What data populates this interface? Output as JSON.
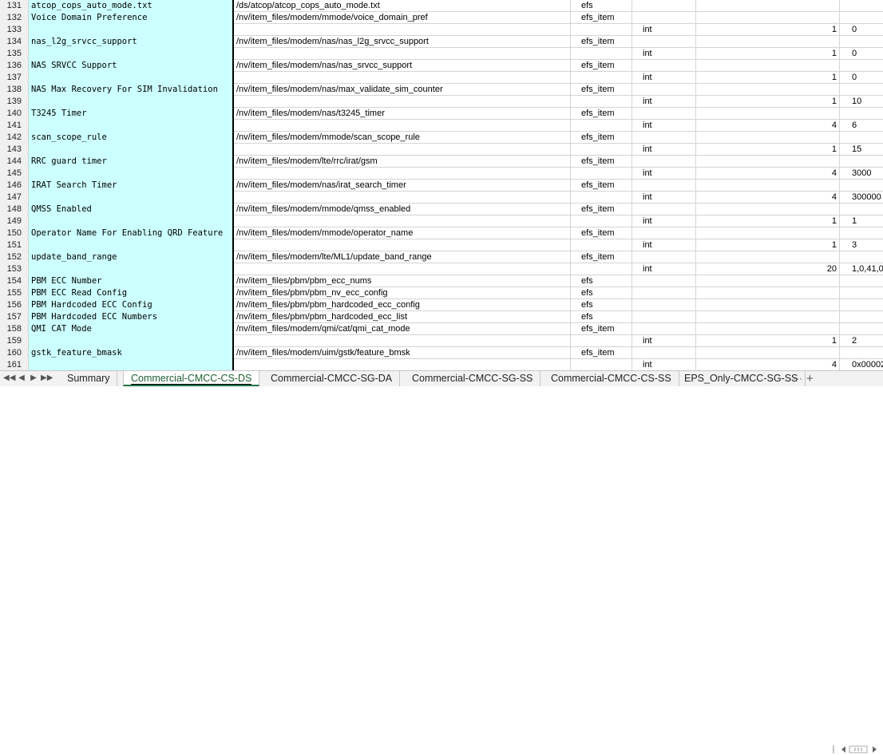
{
  "rows": [
    {
      "num": "131",
      "name": "atcop_cops_auto_mode.txt",
      "path": "/ds/atcop/atcop_cops_auto_mode.txt",
      "type": "efs",
      "c4": "",
      "size": "",
      "val": ""
    },
    {
      "num": "132",
      "name": "Voice Domain Preference",
      "path": "/nv/item_files/modem/mmode/voice_domain_pref",
      "type": "efs_item",
      "c4": "",
      "size": "",
      "val": ""
    },
    {
      "num": "133",
      "name": "",
      "path": "",
      "type": "",
      "c4": "int",
      "size": "1",
      "val": "0"
    },
    {
      "num": "134",
      "name": "nas_l2g_srvcc_support",
      "path": "/nv/item_files/modem/nas/nas_l2g_srvcc_support",
      "type": "efs_item",
      "c4": "",
      "size": "",
      "val": ""
    },
    {
      "num": "135",
      "name": "",
      "path": "",
      "type": "",
      "c4": "int",
      "size": "1",
      "val": "0"
    },
    {
      "num": "136",
      "name": "NAS SRVCC Support",
      "path": "/nv/item_files/modem/nas/nas_srvcc_support",
      "type": "efs_item",
      "c4": "",
      "size": "",
      "val": ""
    },
    {
      "num": "137",
      "name": "",
      "path": "",
      "type": "",
      "c4": "int",
      "size": "1",
      "val": "0"
    },
    {
      "num": "138",
      "name": "NAS Max Recovery For SIM Invalidation",
      "path": "/nv/item_files/modem/nas/max_validate_sim_counter",
      "type": "efs_item",
      "c4": "",
      "size": "",
      "val": ""
    },
    {
      "num": "139",
      "name": "",
      "path": "",
      "type": "",
      "c4": "int",
      "size": "1",
      "val": "10"
    },
    {
      "num": "140",
      "name": "T3245 Timer",
      "path": "/nv/item_files/modem/nas/t3245_timer",
      "type": "efs_item",
      "c4": "",
      "size": "",
      "val": ""
    },
    {
      "num": "141",
      "name": "",
      "path": "",
      "type": "",
      "c4": "int",
      "size": "4",
      "val": "6"
    },
    {
      "num": "142",
      "name": "scan_scope_rule",
      "path": "/nv/item_files/modem/mmode/scan_scope_rule",
      "type": "efs_item",
      "c4": "",
      "size": "",
      "val": ""
    },
    {
      "num": "143",
      "name": "",
      "path": "",
      "type": "",
      "c4": "int",
      "size": "1",
      "val": "15"
    },
    {
      "num": "144",
      "name": "RRC guard timer",
      "path": "/nv/item_files/modem/lte/rrc/irat/gsm",
      "type": "efs_item",
      "c4": "",
      "size": "",
      "val": ""
    },
    {
      "num": "145",
      "name": "",
      "path": "",
      "type": "",
      "c4": "int",
      "size": "4",
      "val": "3000"
    },
    {
      "num": "146",
      "name": "IRAT Search Timer",
      "path": "/nv/item_files/modem/nas/irat_search_timer",
      "type": "efs_item",
      "c4": "",
      "size": "",
      "val": ""
    },
    {
      "num": "147",
      "name": "",
      "path": "",
      "type": "",
      "c4": "int",
      "size": "4",
      "val": "300000"
    },
    {
      "num": "148",
      "name": "QMSS Enabled",
      "path": "/nv/item_files/modem/mmode/qmss_enabled",
      "type": "efs_item",
      "c4": "",
      "size": "",
      "val": ""
    },
    {
      "num": "149",
      "name": "",
      "path": "",
      "type": "",
      "c4": "int",
      "size": "1",
      "val": "1"
    },
    {
      "num": "150",
      "name": "Operator Name For Enabling QRD Feature",
      "path": "/nv/item_files/modem/mmode/operator_name",
      "type": "efs_item",
      "c4": "",
      "size": "",
      "val": ""
    },
    {
      "num": "151",
      "name": "",
      "path": "",
      "type": "",
      "c4": "int",
      "size": "1",
      "val": "3"
    },
    {
      "num": "152",
      "name": "update_band_range",
      "path": "/nv/item_files/modem/lte/ML1/update_band_range",
      "type": "efs_item",
      "c4": "",
      "size": "",
      "val": ""
    },
    {
      "num": "153",
      "name": "",
      "path": "",
      "type": "",
      "c4": "int",
      "size": "20",
      "val": "1,0,41,0"
    },
    {
      "num": "154",
      "name": "PBM ECC Number",
      "path": "/nv/item_files/pbm/pbm_ecc_nums",
      "type": "efs",
      "c4": "",
      "size": "",
      "val": ""
    },
    {
      "num": "155",
      "name": "PBM ECC Read Config",
      "path": "/nv/item_files/pbm/pbm_nv_ecc_config",
      "type": "efs",
      "c4": "",
      "size": "",
      "val": ""
    },
    {
      "num": "156",
      "name": "PBM Hardcoded ECC Config",
      "path": "/nv/item_files/pbm/pbm_hardcoded_ecc_config",
      "type": "efs",
      "c4": "",
      "size": "",
      "val": ""
    },
    {
      "num": "157",
      "name": "PBM Hardcoded ECC Numbers",
      "path": "/nv/item_files/pbm/pbm_hardcoded_ecc_list",
      "type": "efs",
      "c4": "",
      "size": "",
      "val": ""
    },
    {
      "num": "158",
      "name": "QMI CAT Mode",
      "path": "/nv/item_files/modem/qmi/cat/qmi_cat_mode",
      "type": "efs_item",
      "c4": "",
      "size": "",
      "val": ""
    },
    {
      "num": "159",
      "name": "",
      "path": "",
      "type": "",
      "c4": "int",
      "size": "1",
      "val": "2"
    },
    {
      "num": "160",
      "name": "gstk_feature_bmask",
      "path": "/nv/item_files/modem/uim/gstk/feature_bmsk",
      "type": "efs_item",
      "c4": "",
      "size": "",
      "val": ""
    },
    {
      "num": "161",
      "name": "",
      "path": "",
      "type": "",
      "c4": "int",
      "size": "4",
      "val": "0x00002"
    }
  ],
  "tabs": [
    {
      "label": "Summary",
      "active": false
    },
    {
      "label": "Commercial-CMCC-CS-DS",
      "active": true
    },
    {
      "label": "Commercial-CMCC-SG-DA",
      "active": false
    },
    {
      "label": "Commercial-CMCC-SG-SS",
      "active": false
    },
    {
      "label": "Commercial-CMCC-CS-SS",
      "active": false
    },
    {
      "label": "EPS_Only-CMCC-SG-SS",
      "active": false
    }
  ],
  "tabbar": {
    "more": "···",
    "add": "+"
  }
}
